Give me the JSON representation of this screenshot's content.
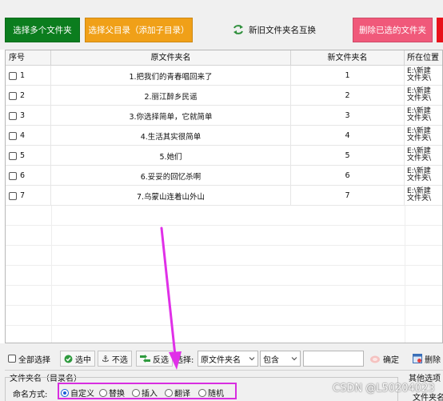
{
  "toolbar": {
    "select_multiple_folders": "选择多个文件夹",
    "select_parent_dir": "选择父目录（添加子目录）",
    "swap_names": "新旧文件夹名互换",
    "delete_selected": "删除已选的文件夹"
  },
  "grid": {
    "headers": {
      "index": "序号",
      "original": "原文件夹名",
      "new": "新文件夹名",
      "location": "所在位置"
    },
    "rows": [
      {
        "index": "1",
        "original": "1.把我们的青春唱回来了",
        "new": "1",
        "location_line1": "E:\\新建",
        "location_line2": "文件夹\\"
      },
      {
        "index": "2",
        "original": "2.丽江醉乡民谣",
        "new": "2",
        "location_line1": "E:\\新建",
        "location_line2": "文件夹\\"
      },
      {
        "index": "3",
        "original": "3.你选择简单，它就简单",
        "new": "3",
        "location_line1": "E:\\新建",
        "location_line2": "文件夹\\"
      },
      {
        "index": "4",
        "original": "4.生活其实很简单",
        "new": "4",
        "location_line1": "E:\\新建",
        "location_line2": "文件夹\\"
      },
      {
        "index": "5",
        "original": "5.她们",
        "new": "5",
        "location_line1": "E:\\新建",
        "location_line2": "文件夹\\"
      },
      {
        "index": "6",
        "original": "6.妥妥的回忆杀啊",
        "new": "6",
        "location_line1": "E:\\新建",
        "location_line2": "文件夹\\"
      },
      {
        "index": "7",
        "original": "7.乌蒙山连着山外山",
        "new": "7",
        "location_line1": "E:\\新建",
        "location_line2": "文件夹\\"
      }
    ]
  },
  "filter": {
    "select_all": "全部选择",
    "select": "选中",
    "deselect": "不选",
    "invert": "反选",
    "choose_label": "选择:",
    "field_value": "原文件夹名",
    "match_value": "包含",
    "keyword_value": "",
    "confirm": "确定",
    "delete_truncated": "删除"
  },
  "naming": {
    "group_title": "文件夹名（目录名）",
    "mode_label": "命名方式:",
    "options": [
      "自定义",
      "替换",
      "插入",
      "翻译",
      "随机"
    ],
    "selected": "自定义"
  },
  "other": {
    "title": "其他选项",
    "subtitle": "文件夹名"
  },
  "watermark": "CSDN @L50204023",
  "colors": {
    "green_button": "#0b7d1e",
    "orange_button": "#f0a018",
    "pink_button": "#f0597a",
    "red_button": "#e8121a",
    "highlight_magenta": "#d82ee0"
  }
}
